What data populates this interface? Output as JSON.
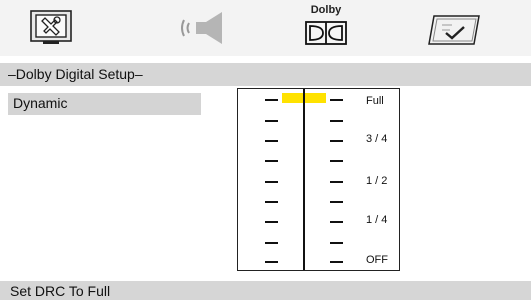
{
  "toolbar": {
    "icons": [
      "general-setup-icon",
      "audio-speaker-icon",
      "dolby-icon",
      "preferences-check-icon"
    ],
    "dolby_label": "Dolby"
  },
  "menu": {
    "title": "–Dolby Digital Setup–"
  },
  "left_panel": {
    "items": [
      {
        "label": "Dynamic",
        "selected": true
      }
    ]
  },
  "drc_slider": {
    "levels": [
      "Full",
      "3 / 4",
      "1 / 2",
      "1 / 4",
      "OFF"
    ],
    "current_level": "Full",
    "highlight_color": "#ffe200"
  },
  "status": {
    "text": "Set DRC To Full"
  }
}
